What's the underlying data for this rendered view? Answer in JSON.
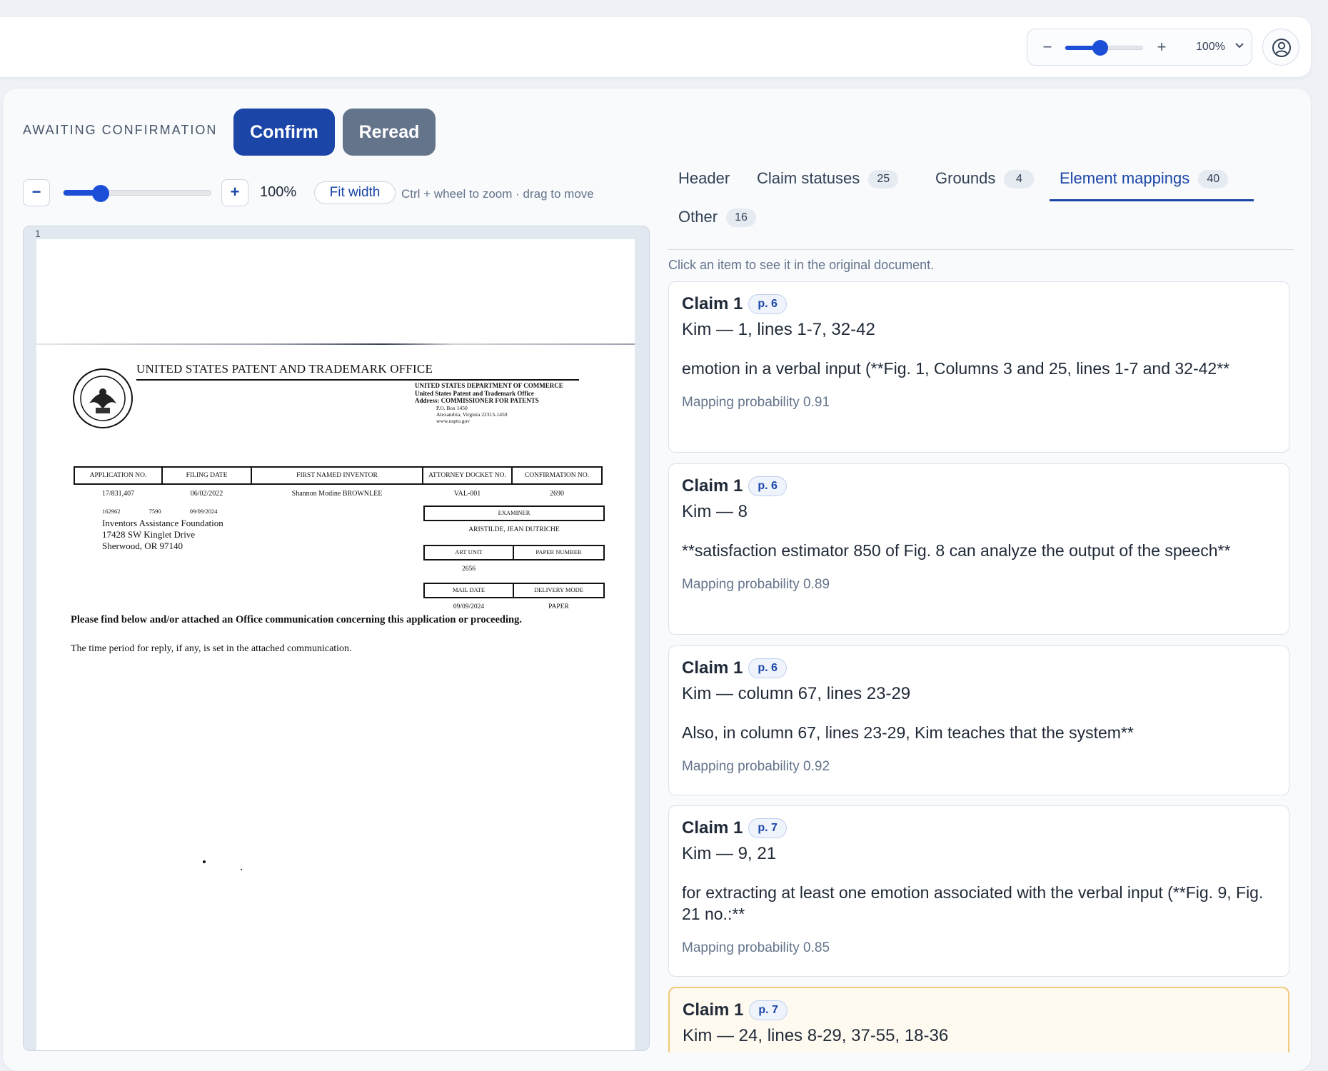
{
  "topbar": {
    "zoom_minus": "−",
    "zoom_plus": "+",
    "zoom_value": "100%",
    "zoom_slider_fraction": 0.45
  },
  "status": {
    "label": "AWAITING CONFIRMATION",
    "confirm_label": "Confirm",
    "reread_label": "Reread"
  },
  "viewer_toolbar": {
    "minus": "−",
    "plus": "+",
    "zoom_label": "100%",
    "zoom_slider_fraction": 0.25,
    "fit_width_label": "Fit width",
    "hint": "Ctrl + wheel to zoom · drag to move"
  },
  "document": {
    "page_number": "1",
    "office_title": "UNITED STATES PATENT AND TRADEMARK OFFICE",
    "dept_lines": [
      "UNITED STATES DEPARTMENT OF COMMERCE",
      "United States Patent and Trademark Office",
      "Address: COMMISSIONER FOR PATENTS"
    ],
    "dept_sub_lines": [
      "P.O. Box 1450",
      "Alexandria, Virginia 22313-1450",
      "www.uspto.gov"
    ],
    "table_headers": [
      "APPLICATION NO.",
      "FILING DATE",
      "FIRST NAMED INVENTOR",
      "ATTORNEY DOCKET NO.",
      "CONFIRMATION NO."
    ],
    "table_values": [
      "17/831,407",
      "06/02/2022",
      "Shannon Modine BROWNLEE",
      "VAL-001",
      "2690"
    ],
    "addr_codes": [
      "162962",
      "7590",
      "09/09/2024"
    ],
    "address_lines": [
      "Inventors Assistance Foundation",
      "17428 SW Kinglet Drive",
      "Sherwood, OR 97140"
    ],
    "examiner_label": "EXAMINER",
    "examiner_value": "ARISTILDE, JEAN DUTRICHE",
    "art_unit_label": "ART UNIT",
    "paper_number_label": "PAPER NUMBER",
    "art_unit_value": "2656",
    "mail_date_label": "MAIL DATE",
    "delivery_mode_label": "DELIVERY MODE",
    "mail_date_value": "09/09/2024",
    "delivery_mode_value": "PAPER",
    "notice_bold": "Please find below and/or attached an Office communication concerning this application or proceeding.",
    "notice_reply": "The time period for reply, if any, is set in the attached communication."
  },
  "tabs": [
    {
      "label": "Header",
      "count": ""
    },
    {
      "label": "Claim statuses",
      "count": "25"
    },
    {
      "label": "Grounds",
      "count": "4"
    },
    {
      "label": "Element mappings",
      "count": "40"
    },
    {
      "label": "Other",
      "count": "16"
    }
  ],
  "hint": "Click an item to see it in the original document.",
  "cards": [
    {
      "title": "Claim 1",
      "page": "p. 6",
      "ref": "Kim — 1, lines 1-7, 32-42",
      "text": "emotion in a verbal input (**Fig. 1, Columns 3 and 25, lines 1-7 and 32-42**",
      "prob": "Mapping probability 0.91"
    },
    {
      "title": "Claim 1",
      "page": "p. 6",
      "ref": "Kim — 8",
      "text": "**satisfaction estimator 850 of Fig. 8 can analyze the output of the speech**",
      "prob": "Mapping probability 0.89"
    },
    {
      "title": "Claim 1",
      "page": "p. 6",
      "ref": "Kim — column 67, lines 23-29",
      "text": "Also, in column 67, lines 23-29, Kim teaches that the system**",
      "prob": "Mapping probability 0.92"
    },
    {
      "title": "Claim 1",
      "page": "p. 7",
      "ref": "Kim — 9, 21",
      "text": "for extracting at least one emotion associated with the verbal input (**Fig. 9, Fig. 21 no.:**",
      "prob": "Mapping probability 0.85"
    },
    {
      "title": "Claim 1",
      "page": "p. 7",
      "ref": "Kim — 24, lines 8-29, 37-55, 18-36",
      "text": "",
      "prob": ""
    }
  ]
}
